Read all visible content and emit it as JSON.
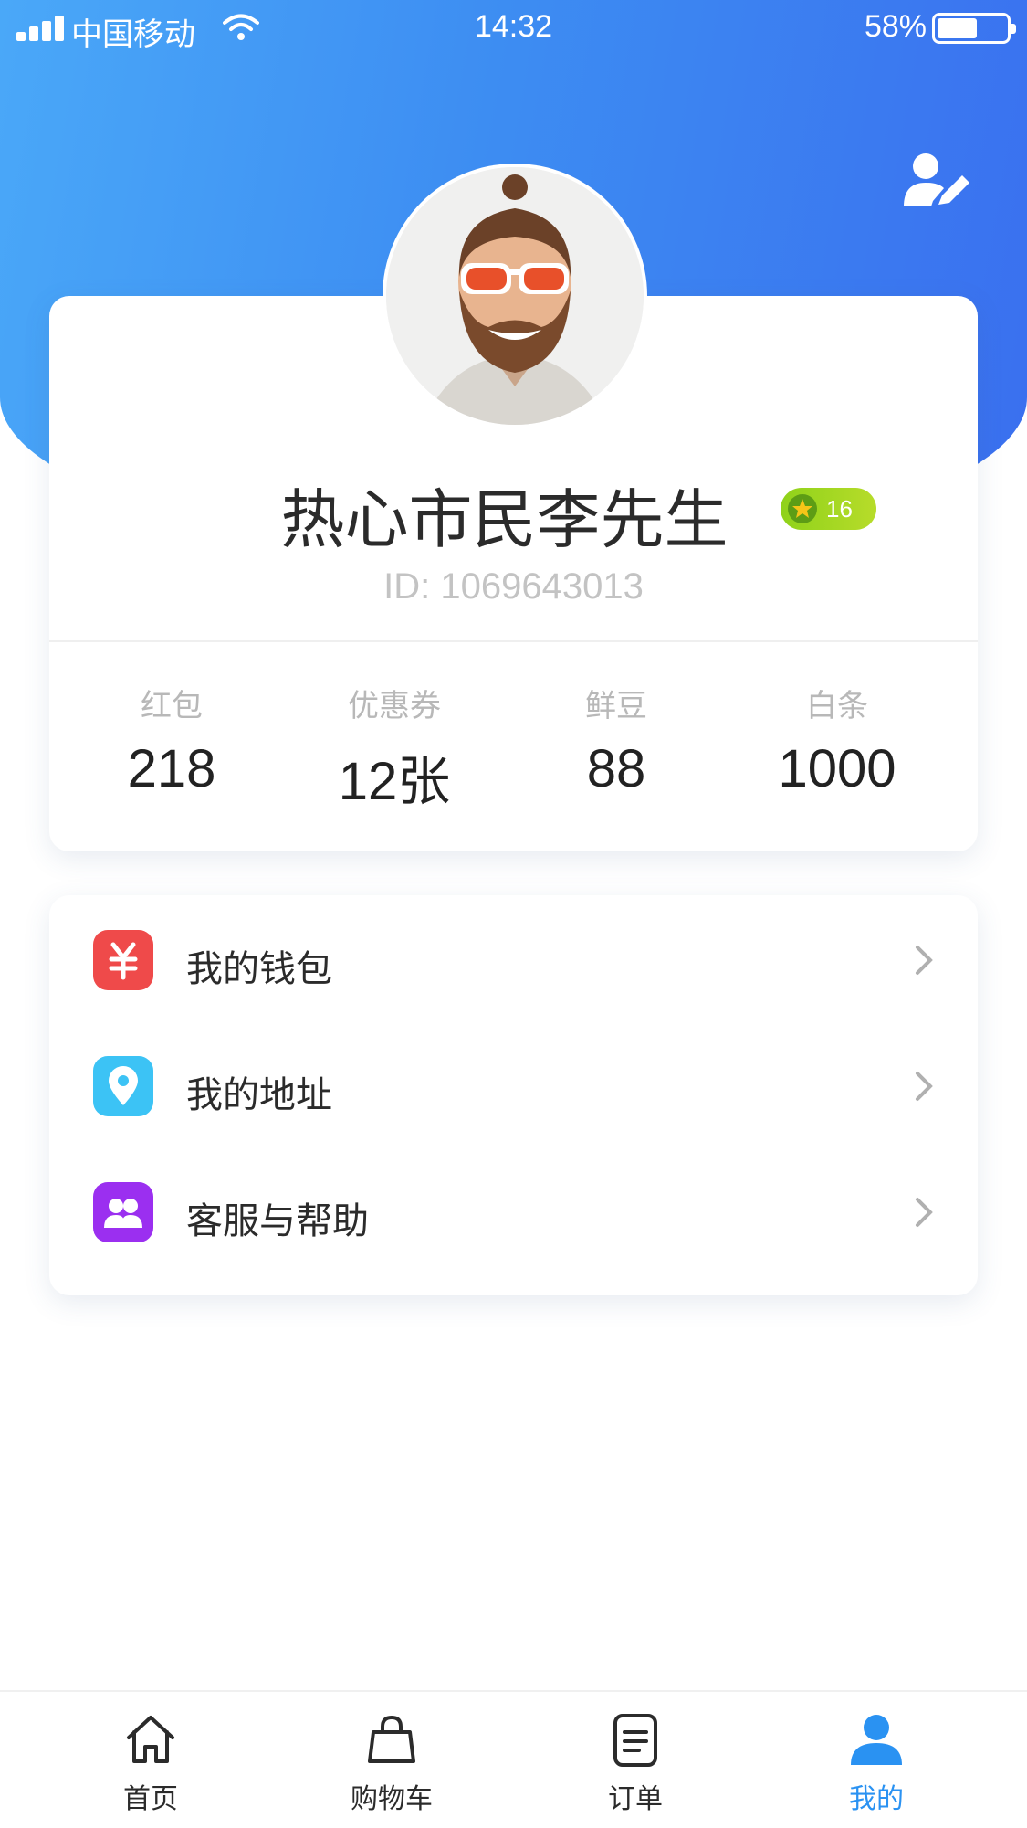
{
  "status_bar": {
    "carrier": "中国移动",
    "time": "14:32",
    "battery_percent_text": "58%",
    "battery_level": 0.58
  },
  "profile": {
    "name": "热心市民李先生",
    "level": "16",
    "id_text": "ID: 1069643013",
    "stats": [
      {
        "label": "红包",
        "value": "218"
      },
      {
        "label": "优惠券",
        "value": "12张"
      },
      {
        "label": "鲜豆",
        "value": "88"
      },
      {
        "label": "白条",
        "value": "1000"
      }
    ]
  },
  "menu": [
    {
      "label": "我的钱包",
      "icon": "yuan-wallet-icon",
      "color": "#ef4a4a"
    },
    {
      "label": "我的地址",
      "icon": "location-pin-icon",
      "color": "#3cc3f5"
    },
    {
      "label": "客服与帮助",
      "icon": "customer-service-icon",
      "color": "#9b2ff0"
    }
  ],
  "tabbar": [
    {
      "label": "首页",
      "icon": "home-icon"
    },
    {
      "label": "购物车",
      "icon": "shopping-bag-icon"
    },
    {
      "label": "订单",
      "icon": "order-list-icon"
    },
    {
      "label": "我的",
      "icon": "person-icon",
      "active": true
    }
  ],
  "colors": {
    "header_gradient_start": "#4aa8f8",
    "header_gradient_end": "#3a6fef",
    "active_tab": "#2a92f2",
    "level_badge": "#9bd21e"
  }
}
